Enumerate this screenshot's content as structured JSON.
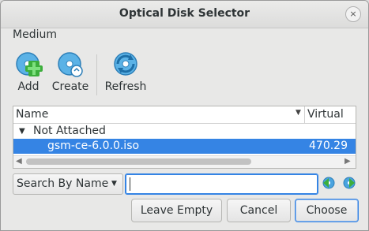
{
  "window": {
    "title": "Optical Disk Selector",
    "close_glyph": "×"
  },
  "menubar": {
    "items": [
      {
        "label": "Medium"
      }
    ]
  },
  "toolbar": {
    "add": {
      "label": "Add",
      "icon": "add-disk-icon"
    },
    "create": {
      "label": "Create",
      "icon": "create-disk-icon"
    },
    "refresh": {
      "label": "Refresh",
      "icon": "refresh-icon"
    }
  },
  "tree": {
    "columns": {
      "name": "Name",
      "virtual": "Virtual"
    },
    "groups": [
      {
        "label": "Not Attached",
        "items": [
          {
            "name": "gsm-ce-6.0.0.iso",
            "virtual_size": "470.29"
          }
        ]
      }
    ]
  },
  "search": {
    "mode": "Search By Name",
    "value": ""
  },
  "buttons": {
    "leave_empty": "Leave Empty",
    "cancel": "Cancel",
    "choose": "Choose"
  },
  "colors": {
    "accent": "#3584e4",
    "selection": "#3584e4",
    "icon_green": "#3cae3c",
    "icon_blue": "#4aa3df"
  }
}
